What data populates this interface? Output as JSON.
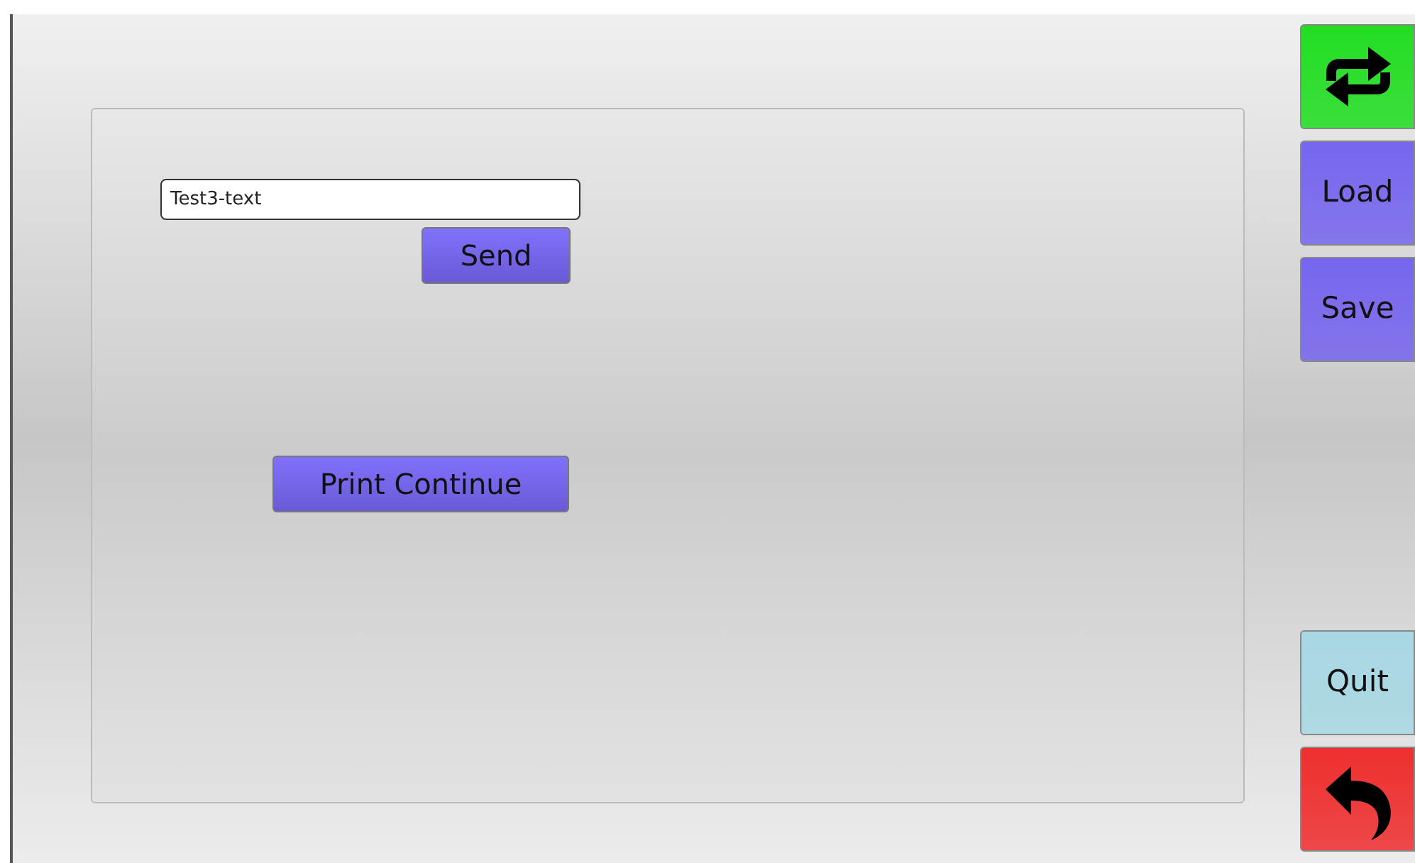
{
  "panel": {
    "input": {
      "value": "Test3-text"
    },
    "send_button": "Send",
    "print_button": "Print Continue"
  },
  "side_top": [
    {
      "kind": "swap",
      "color": "#22dd22"
    },
    {
      "kind": "text",
      "label": "Load",
      "color": "#7766ee"
    },
    {
      "kind": "text",
      "label": "Save",
      "color": "#7766ee"
    }
  ],
  "side_bottom": [
    {
      "kind": "text",
      "label": "Quit",
      "color": "#a8d8e4"
    },
    {
      "kind": "back",
      "color": "#ee2f2f"
    }
  ]
}
